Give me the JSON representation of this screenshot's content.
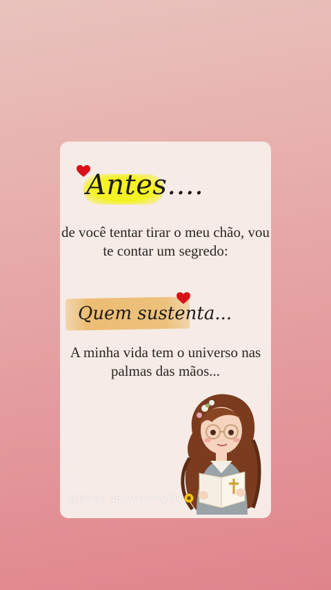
{
  "card": {
    "title1": "Antes....",
    "paragraph1": "de você tentar tirar o meu chão, vou te contar um segredo:",
    "title2": "Quem sustenta...",
    "paragraph2": "A minha vida tem o universo nas palmas das mãos...",
    "watermark": "@DOSE DE MOTIVAÇÃO"
  },
  "icons": {
    "heart": "heart-icon",
    "girl": "girl-with-bible-illustration",
    "watermark_emoji": "sunflower-icon"
  },
  "colors": {
    "heart": "#d8101a",
    "highlight_yellow": "#f4f224",
    "highlight_orange": "#ecbd73",
    "card_bg": "#f6ebe6"
  }
}
